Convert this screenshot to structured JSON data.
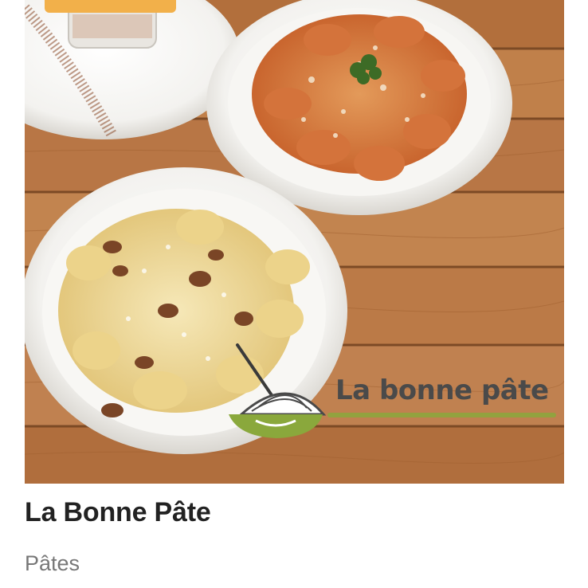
{
  "restaurant": {
    "name": "La Bonne Pâte",
    "category": "Pâtes",
    "photo": {
      "logo_text": "La bonne pâte",
      "logo_icon": "pasta-bowl-icon"
    }
  },
  "colors": {
    "wood": "#b5713e",
    "badge": "#f2b04a",
    "logo_green": "#8aa83c",
    "logo_text": "#4a4a4a"
  }
}
